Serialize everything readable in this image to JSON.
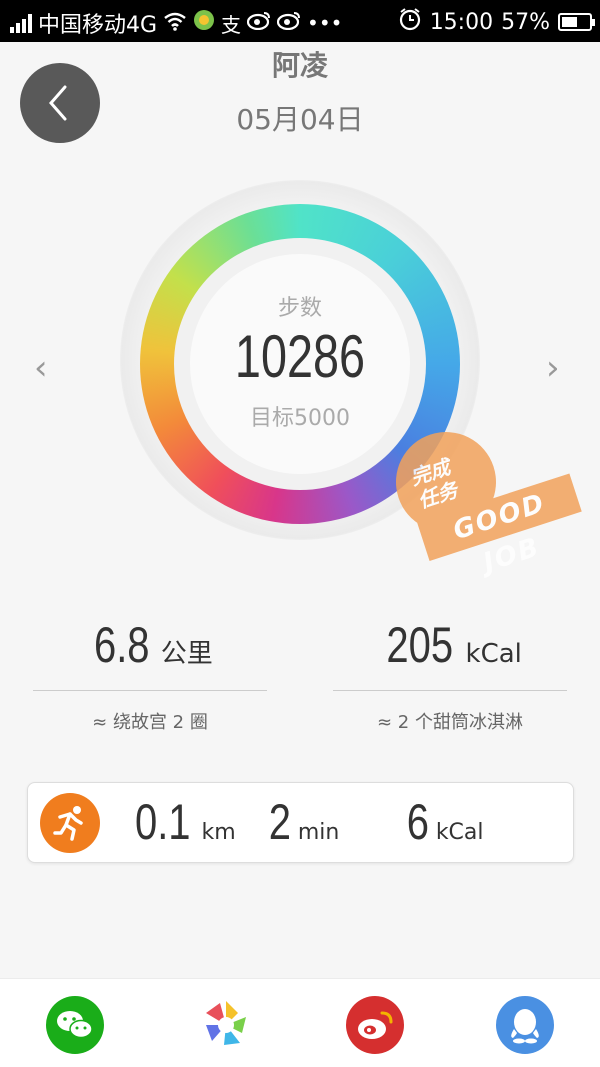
{
  "status_bar": {
    "carrier": "中国移动4G",
    "time": "15:00",
    "battery": "57%",
    "battery_level": 0.57,
    "icons": [
      "signal-icon",
      "wifi-icon",
      "app-icon",
      "alipay-icon",
      "weibo-icon",
      "weibo-icon",
      "more-icon",
      "alarm-icon",
      "battery-icon"
    ]
  },
  "header": {
    "name": "阿凌",
    "date": "05月04日",
    "back_icon": "back-arrow-icon"
  },
  "ring": {
    "label": "步数",
    "value": "10286",
    "goal": "目标5000",
    "prev_arrow": "‹",
    "next_arrow": "›"
  },
  "stamp": {
    "line1": "完成",
    "line2": "任务",
    "band": "GOOD JOB",
    "color": "#f2a25b"
  },
  "stats": {
    "distance": {
      "value": "6.8",
      "unit": "公里",
      "note": "≈ 绕故宫 2 圈"
    },
    "calories": {
      "value": "205",
      "unit": "kCal",
      "note": "≈ 2 个甜筒冰淇淋"
    }
  },
  "activity": {
    "icon": "running-icon",
    "icon_color": "#f07d1e",
    "distance": {
      "value": "0.1",
      "unit": "km"
    },
    "duration": {
      "value": "2",
      "unit": "min"
    },
    "calories": {
      "value": "6",
      "unit": "kCal"
    }
  },
  "share_bar": {
    "items": [
      {
        "icon": "wechat-icon",
        "color": "#1aad19"
      },
      {
        "icon": "moments-icon",
        "color": "#ffffff"
      },
      {
        "icon": "weibo-icon",
        "color": "#d52f2f"
      },
      {
        "icon": "qq-icon",
        "color": "#4a90e2"
      }
    ]
  }
}
